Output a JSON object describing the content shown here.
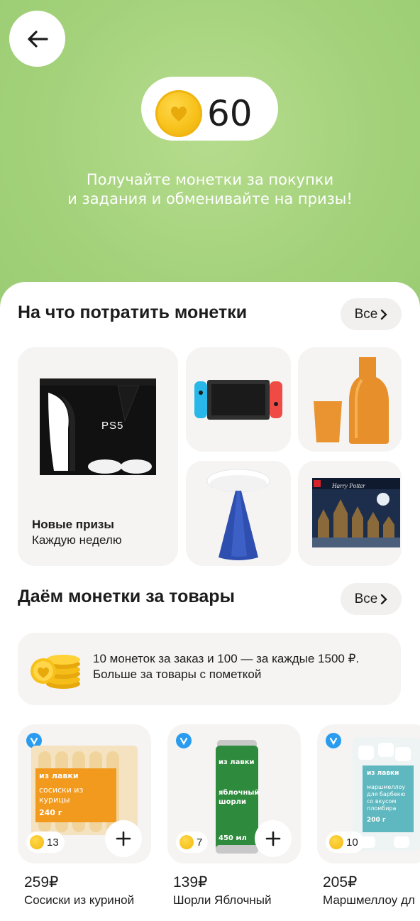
{
  "header": {
    "balance": "60",
    "subtitle_line1": "Получайте монетки за покупки",
    "subtitle_line2": "и задания и обменивайте на призы!"
  },
  "spend_section": {
    "title": "На что потратить монетки",
    "all_label": "Все",
    "featured_title": "Новые призы",
    "featured_subtitle": "Каждую неделю",
    "ps5_label": "PS5",
    "lego_label": "Harry Potter"
  },
  "earn_section": {
    "title": "Даём монетки за товары",
    "all_label": "Все",
    "info_line1": "10 монеток за заказ и 100 — за каждые 1500 ₽.",
    "info_line2": "Больше за товары с пометкой"
  },
  "products": [
    {
      "coins": "13",
      "price": "259₽",
      "name": "Сосиски из куриной",
      "pack_brand": "из лавки",
      "pack_name": "сосиски из курицы",
      "pack_weight": "240 г"
    },
    {
      "coins": "7",
      "price": "139₽",
      "name": "Шорли Яблочный",
      "pack_brand": "из лавки",
      "pack_name": "яблочный шорли",
      "pack_weight": "450 мл"
    },
    {
      "coins": "10",
      "price": "205₽",
      "name": "Маршмеллоу дл",
      "pack_brand": "из лавки",
      "pack_name": "маршмеллоу для барбекю со вкусом пломбира",
      "pack_weight": "200 г"
    }
  ],
  "colors": {
    "hero_green": "#a2d17a",
    "coin_yellow": "#f7c11a",
    "tile_bg": "#f5f4f2",
    "badge_blue": "#2a9cf0"
  },
  "icons": [
    "back-arrow-icon",
    "coin-icon",
    "chevron-right-icon",
    "verified-badge-icon",
    "plus-icon"
  ]
}
